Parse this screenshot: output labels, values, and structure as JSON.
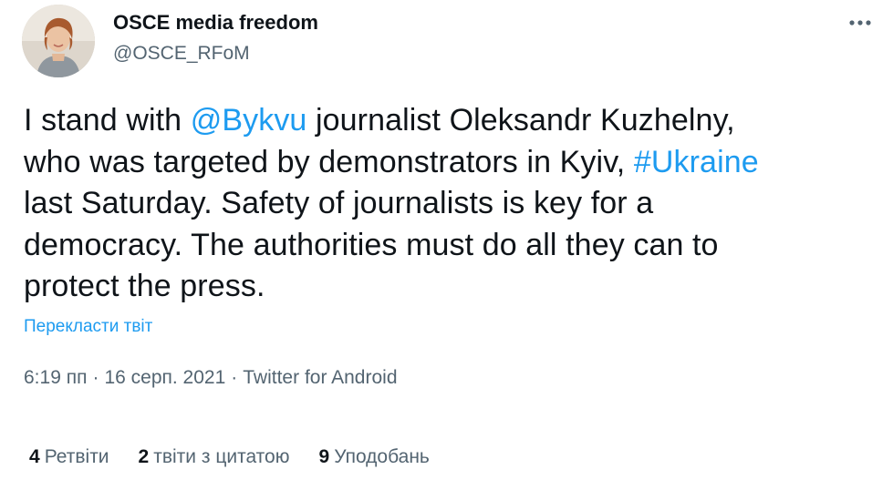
{
  "user": {
    "display_name": "OSCE media freedom",
    "handle": "@OSCE_RFoM"
  },
  "tweet": {
    "segments": [
      {
        "text": "I stand with ",
        "type": "text"
      },
      {
        "text": "@Bykvu",
        "type": "mention"
      },
      {
        "text": " journalist Oleksandr Kuzhelny,",
        "type": "text"
      },
      {
        "text": "who was targeted by demonstrators in Kyiv, ",
        "type": "text"
      },
      {
        "text": "#Ukraine",
        "type": "hashtag"
      },
      {
        "text": "last Saturday. Safety of journalists is key for a",
        "type": "text"
      },
      {
        "text": "democracy. The authorities must do all they can to",
        "type": "text"
      },
      {
        "text": "protect the press.",
        "type": "text"
      }
    ],
    "translate_label": "Перекласти твіт"
  },
  "meta": {
    "time": "6:19 пп",
    "separator": "·",
    "date": "16 серп. 2021",
    "source": "Twitter for Android"
  },
  "stats": {
    "retweets": {
      "count": "4",
      "label": "Ретвіти"
    },
    "quotes": {
      "count": "2",
      "label": "твіти з цитатою"
    },
    "likes": {
      "count": "9",
      "label": "Уподобань"
    }
  },
  "icons": {
    "more": "more-horizontal-icon",
    "avatar": "profile-photo"
  },
  "colors": {
    "link": "#1d9bf0",
    "secondary_text": "#536471",
    "primary_text": "#0f1419"
  }
}
